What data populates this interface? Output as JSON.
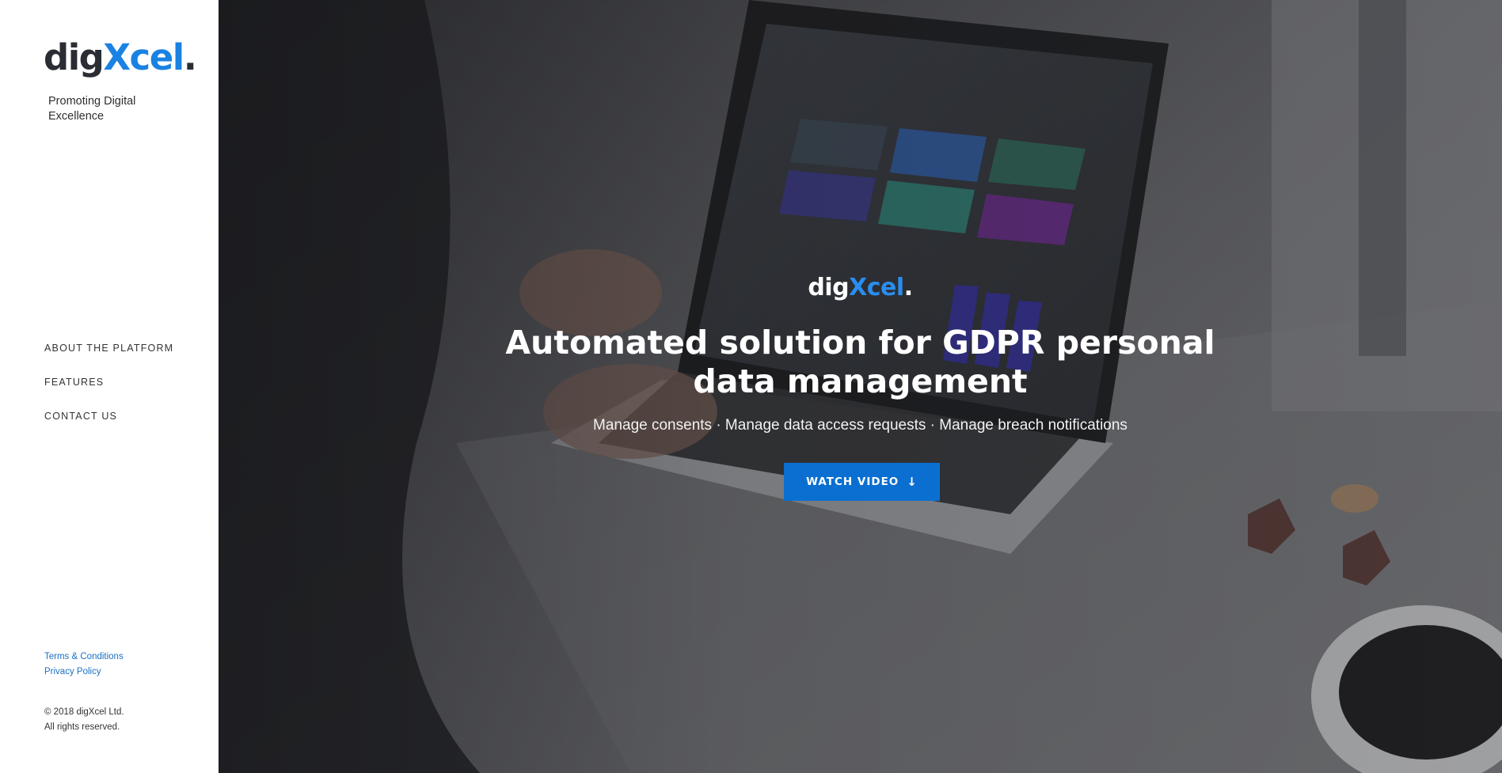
{
  "brand": {
    "logo_dark": "dig",
    "logo_blue": "Xcel",
    "logo_dot": ".",
    "tagline": "Promoting Digital Excellence",
    "accent": "#1a82e2"
  },
  "nav": {
    "items": [
      {
        "label": "ABOUT THE PLATFORM"
      },
      {
        "label": "FEATURES"
      },
      {
        "label": "CONTACT US"
      }
    ]
  },
  "legal": {
    "terms": "Terms & Conditions",
    "privacy": "Privacy Policy"
  },
  "footer": {
    "copyright": "© 2018 digXcel Ltd.",
    "rights": "All rights reserved."
  },
  "hero": {
    "logo_white": "dig",
    "logo_blue": "Xcel",
    "logo_dot": ".",
    "headline": "Automated solution for GDPR personal data management",
    "subline": "Manage consents · Manage data access requests · Manage breach notifications",
    "cta_label": "WATCH VIDEO",
    "cta_icon": "arrow-down-icon",
    "cta_color": "#0a6fd1"
  }
}
